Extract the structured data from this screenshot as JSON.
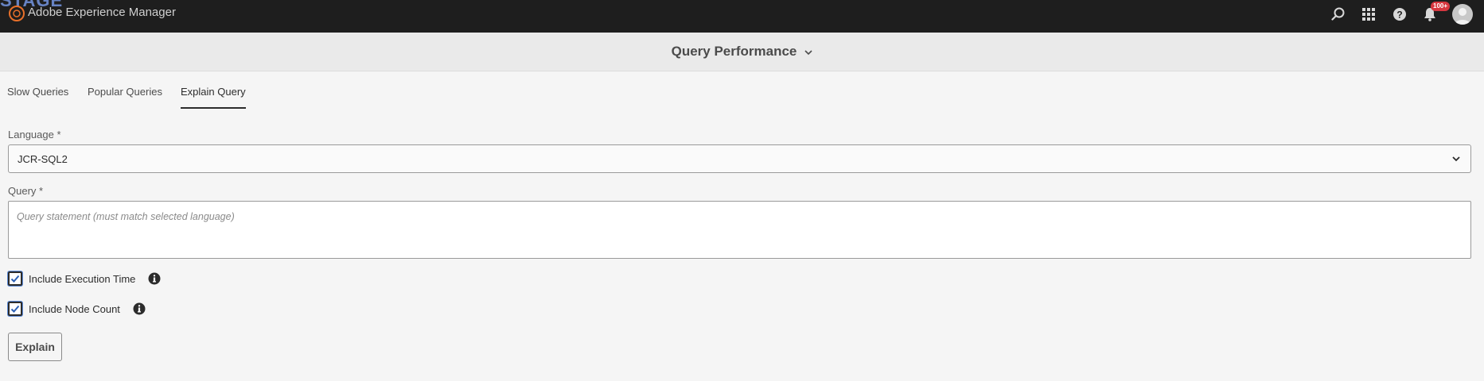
{
  "shell": {
    "stage_mark": "STAGE",
    "brand": "Adobe Experience Manager",
    "notification_count": "100+",
    "icons": [
      "search-icon",
      "apps-grid-icon",
      "help-icon",
      "bell-icon"
    ]
  },
  "header": {
    "title": "Query Performance"
  },
  "tabs": [
    {
      "label": "Slow Queries",
      "active": false
    },
    {
      "label": "Popular Queries",
      "active": false
    },
    {
      "label": "Explain Query",
      "active": true
    }
  ],
  "form": {
    "language_label": "Language *",
    "language_value": "JCR-SQL2",
    "query_label": "Query *",
    "query_placeholder": "Query statement (must match selected language)",
    "checkboxes": [
      {
        "label": "Include Execution Time",
        "checked": true
      },
      {
        "label": "Include Node Count",
        "checked": true
      }
    ],
    "explain_button": "Explain"
  },
  "colors": {
    "shell_bg": "#1e1e1e",
    "page_bg": "#f5f5f5",
    "badge": "#d7373f",
    "focus_ring": "#5b8ad8"
  }
}
